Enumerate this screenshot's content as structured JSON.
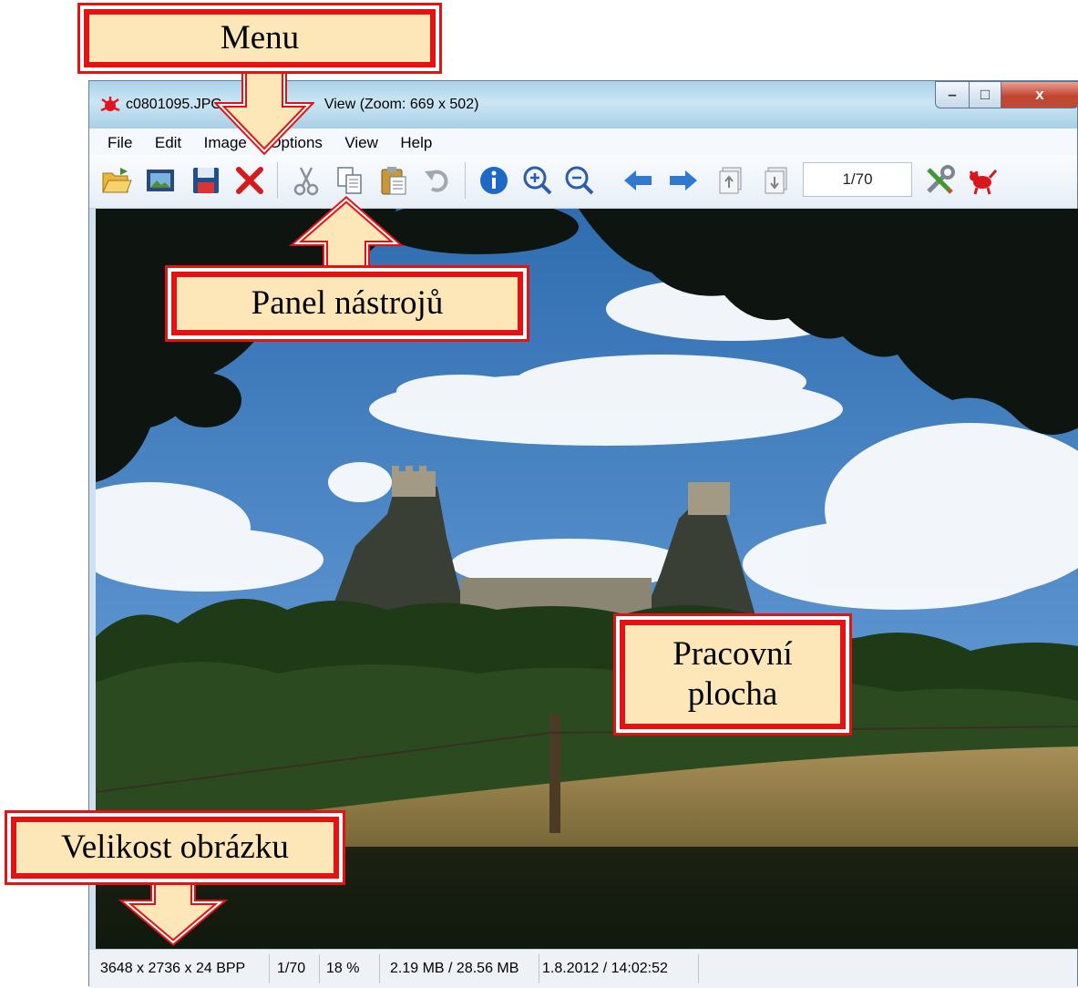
{
  "window": {
    "title": "c0801095.JPG - IrfanView (Zoom: 669 x 502)",
    "title_visible": "c0801095.JPG",
    "title_visible_tail": "View (Zoom: 669 x 502)",
    "buttons": {
      "minimize": "–",
      "maximize": "□",
      "close": "x"
    }
  },
  "menu": {
    "items": [
      {
        "label": "File"
      },
      {
        "label": "Edit"
      },
      {
        "label": "Image"
      },
      {
        "label": "Options"
      },
      {
        "label": "View"
      },
      {
        "label": "Help"
      }
    ]
  },
  "toolbar": {
    "buttons": [
      "open-icon",
      "thumbnails-icon",
      "save-icon",
      "delete-icon",
      "cut-icon",
      "copy-icon",
      "paste-icon",
      "undo-icon",
      "info-icon",
      "zoom-in-icon",
      "zoom-out-icon",
      "prev-icon",
      "next-icon",
      "first-page-icon",
      "last-page-icon"
    ],
    "page": "1/70"
  },
  "status": {
    "dimensions": "3648 x 2736 x 24 BPP",
    "page": "1/70",
    "zoom": "18 %",
    "filesize": "2.19 MB / 28.56 MB",
    "datetime": "1.8.2012 / 14:02:52"
  },
  "callouts": {
    "menu": "Menu",
    "toolbar": "Panel nástrojů",
    "workspace_line1": "Pracovní",
    "workspace_line2": "plocha",
    "image_size": "Velikost obrázku"
  },
  "colors": {
    "callout_fill": "#fde6b8",
    "callout_border": "#e41212",
    "sky": "#3f7ec0",
    "meadow": "#a28a50"
  }
}
